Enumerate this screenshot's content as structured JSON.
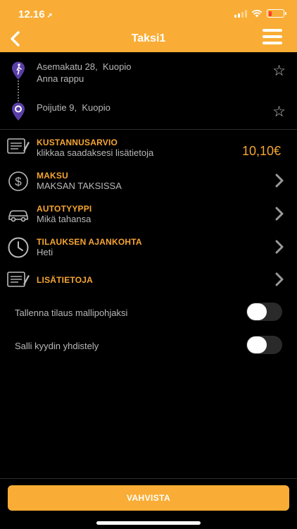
{
  "status": {
    "time": "12.16",
    "location_icon": "location-arrow-icon",
    "battery_color": "#ff3b30"
  },
  "header": {
    "title": "Taksi1",
    "back_icon": "chevron-left-icon",
    "menu_icon": "hamburger-menu-icon",
    "color": "#f9ad36"
  },
  "route": {
    "pickup": {
      "street": "Asemakatu 28,",
      "city": "Kuopio",
      "note": "Anna rappu",
      "icon": "person-pin-icon"
    },
    "destination": {
      "street": "Poijutie 9,",
      "city": "Kuopio",
      "icon": "destination-pin-icon"
    }
  },
  "cost": {
    "label": "KUSTANNUSARVIO",
    "sub": "klikkaa saadaksesi lisätietoja",
    "price": "10,10€"
  },
  "payment": {
    "label": "MAKSU",
    "sub": "MAKSAN TAKSISSA"
  },
  "vehicle": {
    "label": "AUTOTYYPPI",
    "sub": "Mikä tahansa"
  },
  "timing": {
    "label": "TILAUKSEN AJANKOHTA",
    "sub": "Heti"
  },
  "extra": {
    "label": "LISÄTIETOJA"
  },
  "toggles": [
    {
      "label": "Tallenna tilaus mallipohjaksi",
      "on": false
    },
    {
      "label": "Salli kyydin yhdistely",
      "on": false
    }
  ],
  "confirm_label": "VAHVISTA",
  "accent_color": "#f6a532",
  "pin_color": "#5b3fa8"
}
